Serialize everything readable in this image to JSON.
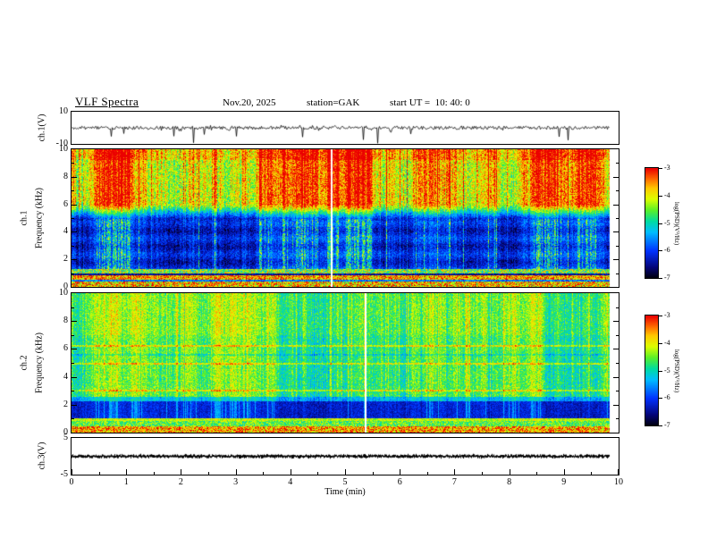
{
  "header": {
    "title": "VLF Spectra",
    "date": "Nov.20, 2025",
    "station": "station=GAK",
    "start_ut": "start UT =  10: 40: 0"
  },
  "xaxis": {
    "label": "Time (min)",
    "ticks": [
      0,
      1,
      2,
      3,
      4,
      5,
      6,
      7,
      8,
      9,
      10
    ],
    "range": [
      0,
      10
    ],
    "data_end_min": 9.83
  },
  "colorbar": {
    "label": "log(PSD)(V²/Hz)",
    "ticks": [
      -3,
      -4,
      -5,
      -6,
      -7
    ],
    "range": [
      -7,
      -3
    ]
  },
  "chart_data": [
    {
      "type": "line",
      "name": "ch1-voltage-waveform",
      "ylabel": "ch.1(V)",
      "ylim": [
        -10,
        10
      ],
      "yticks": [
        10,
        -10
      ],
      "xlim": [
        0,
        10
      ],
      "description": "Raw ch.1 voltage vs time: low-amplitude noise around 0 V with frequent impulsive negative spikes reaching about -10 V and occasional positive spikes; record ends near 9.83 min."
    },
    {
      "type": "heatmap",
      "name": "ch1-spectrogram",
      "channel_label": "ch.1",
      "ylabel": "Frequency (kHz)",
      "ylim": [
        0,
        10
      ],
      "yticks": [
        0,
        2,
        4,
        6,
        8,
        10
      ],
      "zlabel": "log(PSD)(V²/Hz)",
      "zlim": [
        -7,
        -3
      ],
      "description": "Spectrogram of ch.1: intense red/yellow broadband power above ~6 kHz with dense vertical sferic striations, dark blue/black background from ~1.5-5 kHz crossed by green vertical streaks, and bright multicolored horizontal bands below ~1.3 kHz."
    },
    {
      "type": "heatmap",
      "name": "ch2-spectrogram",
      "channel_label": "ch.2",
      "ylabel": "Frequency (kHz)",
      "ylim": [
        0,
        10
      ],
      "yticks": [
        0,
        2,
        4,
        6,
        8,
        10
      ],
      "zlabel": "log(PSD)(V²/Hz)",
      "zlim": [
        -7,
        -3
      ],
      "description": "Spectrogram of ch.2: cyan/green speckled power above ~2.5 kHz with yellow vertical streaks and narrow horizontal emission lines near 6.2, 4.9 and 3.0 kHz, a dark blue band from ~1-2.2 kHz, and bright low-frequency bands with red speckle below ~1 kHz."
    },
    {
      "type": "line",
      "name": "ch3-voltage-waveform",
      "ylabel": "ch.3(V)",
      "ylim": [
        -5,
        5
      ],
      "yticks": [
        5,
        -5
      ],
      "description": "Ch.3 voltage vs time: essentially flat dense dark trace at ~0 V for the entire record."
    }
  ]
}
